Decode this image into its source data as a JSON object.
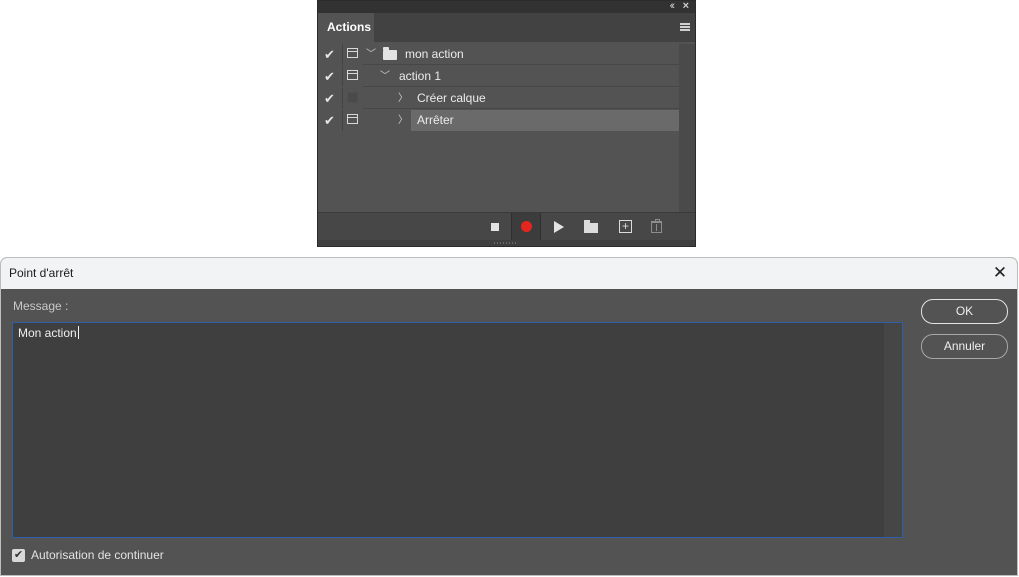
{
  "actions_panel": {
    "tab_label": "Actions",
    "collapse_glyph": "‹‹",
    "close_glyph": "×",
    "rows": [
      {
        "label": "mon action",
        "checked": "✔",
        "caret": "﹀"
      },
      {
        "label": "action 1",
        "checked": "✔",
        "caret": "﹀"
      },
      {
        "label": "Créer calque",
        "checked": "✔",
        "caret": "〉"
      },
      {
        "label": "Arrêter",
        "checked": "✔",
        "caret": "〉"
      }
    ],
    "record_color": "#e5261f",
    "new_glyph": "+"
  },
  "dialog": {
    "title": "Point d'arrêt",
    "close_glyph": "✕",
    "message_label": "Message :",
    "message_value": "Mon action",
    "ok_label": "OK",
    "cancel_label": "Annuler",
    "continue_label": "Autorisation de continuer",
    "continue_checked": "✔",
    "focus_color": "#2f5fa8"
  }
}
